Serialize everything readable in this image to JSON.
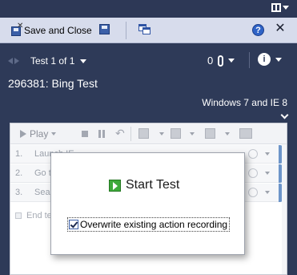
{
  "window": {
    "layout_icon": "split-layout-icon"
  },
  "toolbar": {
    "save_close_label": "Save and Close",
    "save_icon": "save-disk-icon",
    "windows_icon": "multiple-windows-icon",
    "help_label": "?",
    "close_label": "✕"
  },
  "nav": {
    "pager_label": "Test 1 of 1",
    "attachment_count": "0",
    "info_label": "i"
  },
  "test": {
    "title": "296381: Bing Test",
    "configuration": "Windows 7 and IE 8"
  },
  "runner_toolbar": {
    "play_label": "Play"
  },
  "steps": [
    {
      "number": "1.",
      "text": "Launch IE"
    },
    {
      "number": "2.",
      "text": "Go to"
    },
    {
      "number": "3.",
      "text": "Sea"
    }
  ],
  "end_label": "End te",
  "dialog": {
    "start_label": "Start Test",
    "overwrite_label": "Overwrite existing action recording",
    "overwrite_checked": true
  },
  "colors": {
    "background": "#2e3a58",
    "toolbar": "#d7dcec",
    "step_bar": "#6d95c9",
    "start_icon": "#3eaa3b"
  }
}
